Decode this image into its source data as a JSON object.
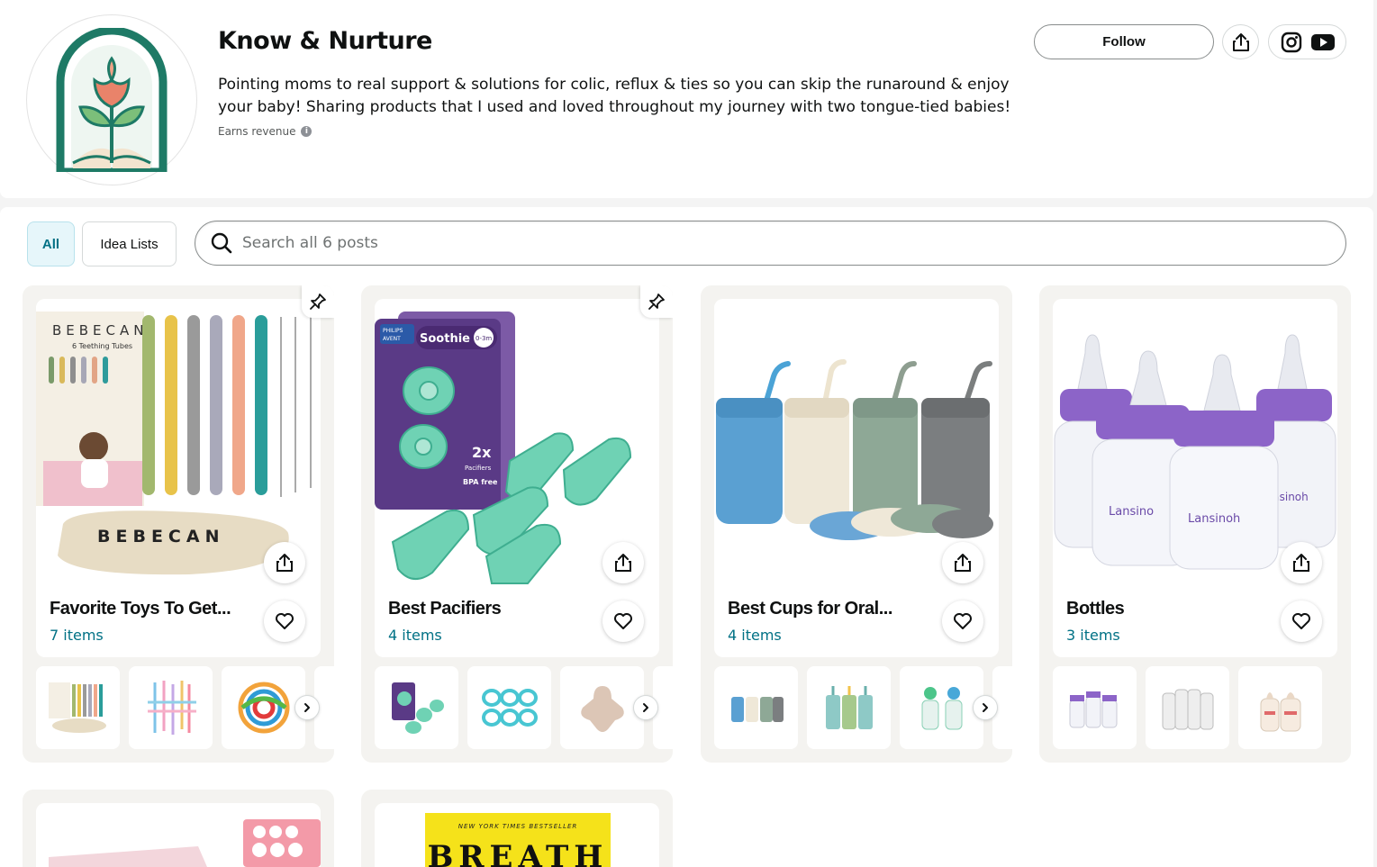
{
  "profile": {
    "name": "Know & Nurture",
    "bio": "Pointing moms to real support & solutions for colic, reflux & ties so you can skip the runaround & enjoy your baby! Sharing products that I used and loved throughout my journey with two tongue-tied babies!",
    "earns_revenue": "Earns revenue",
    "follow_label": "Follow"
  },
  "filters": {
    "all_label": "All",
    "idea_lists_label": "Idea Lists"
  },
  "search": {
    "placeholder": "Search all 6 posts"
  },
  "lists": [
    {
      "title": "Favorite Toys To Get...",
      "count": "7 items",
      "pinned": true
    },
    {
      "title": "Best Pacifiers",
      "count": "4 items",
      "pinned": true
    },
    {
      "title": "Best Cups for Oral...",
      "count": "4 items",
      "pinned": false
    },
    {
      "title": "Bottles",
      "count": "3 items",
      "pinned": false
    }
  ],
  "product_text": {
    "bebecan_brand": "BEBECAN",
    "bebecan_sub": "6 Teething Tubes",
    "avent_brand": "PHILIPS AVENT",
    "soothie": "Soothie",
    "soothie_age": "0-3m",
    "pacifier_count": "2x",
    "pacifier_sub": "Pacifiers",
    "bpa_free": "BPA free",
    "lansinoh": "Lansinoh",
    "nyt": "NEW YORK TIMES BESTSELLER",
    "breath": "BREATH"
  },
  "colors": {
    "accent_teal": "#007185",
    "logo_green": "#1e7a66",
    "logo_coral": "#e9836a",
    "card_bg": "#f4f3f0"
  }
}
